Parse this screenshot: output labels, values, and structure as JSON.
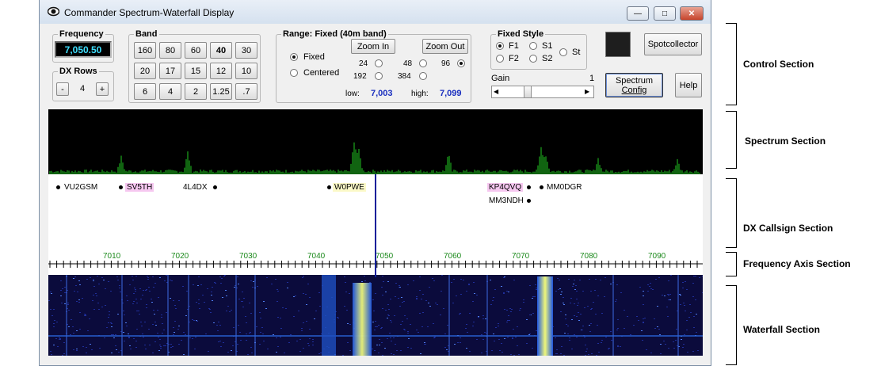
{
  "window": {
    "title": "Commander Spectrum-Waterfall Display",
    "controls": {
      "minimize": "—",
      "maximize": "□",
      "close": "✕"
    }
  },
  "frequency": {
    "legend": "Frequency",
    "value": "7,050.50"
  },
  "dx_rows": {
    "legend": "DX Rows",
    "minus": "-",
    "value": "4",
    "plus": "+"
  },
  "band": {
    "legend": "Band",
    "buttons": [
      "160",
      "80",
      "60",
      "40",
      "30",
      "20",
      "17",
      "15",
      "12",
      "10",
      "6",
      "4",
      "2",
      "1.25",
      ".7"
    ],
    "selected": "40"
  },
  "range": {
    "legend": "Range: Fixed (40m band)",
    "mode_fixed": "Fixed",
    "mode_centered": "Centered",
    "zoom_in": "Zoom In",
    "zoom_out": "Zoom Out",
    "spans": [
      "24",
      "48",
      "96",
      "192",
      "384"
    ],
    "selected_span": "96",
    "low_label": "low:",
    "low_value": "7,003",
    "high_label": "high:",
    "high_value": "7,099"
  },
  "style": {
    "legend": "Fixed Style",
    "options": [
      "F1",
      "S1",
      "F2",
      "S2",
      "St"
    ],
    "selected": "F1"
  },
  "gain": {
    "label": "Gain",
    "value": "1",
    "left_arrow": "◀",
    "right_arrow": "▶"
  },
  "buttons": {
    "spotcollector": "Spotcollector",
    "spectrum_config_line1": "Spectrum",
    "spectrum_config_line2": "Config",
    "help": "Help"
  },
  "color_swatch": "#1e1e1e",
  "spots": [
    {
      "call": "VU2GSM",
      "highlight": ""
    },
    {
      "call": "SV5TH",
      "highlight": "#f6c8f0"
    },
    {
      "call": "4L4DX",
      "highlight": ""
    },
    {
      "call": "W0PWE",
      "highlight": "#fbf9c8"
    },
    {
      "call": "KP4QVQ",
      "highlight": "#f6c8f0"
    },
    {
      "call": "MM0DGR",
      "highlight": ""
    },
    {
      "call": "MM3NDH",
      "highlight": ""
    }
  ],
  "axis": {
    "ticks": [
      "7010",
      "7020",
      "7030",
      "7040",
      "7050",
      "7060",
      "7070",
      "7080",
      "7090"
    ]
  },
  "sections": {
    "control": "Control Section",
    "spectrum": "Spectrum Section",
    "dx": "DX Callsign Section",
    "axis": "Frequency Axis Section",
    "waterfall": "Waterfall Section"
  },
  "colors": {
    "spectrum_trace": "#22c922",
    "freq_display_text": "#3fe0ff",
    "axis_text": "#1d8a1d",
    "range_values": "#1a2fbf",
    "tuning_line": "#0b1f9a"
  }
}
